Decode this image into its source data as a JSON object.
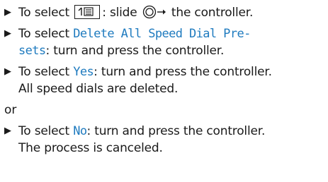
{
  "steps": [
    {
      "pre": "To select ",
      "post": ": slide ",
      "tail": " the controller."
    },
    {
      "pre": "To select ",
      "highlight": "Delete All Speed Dial Pre-",
      "highlight2": "sets",
      "post": ": turn and press the controller."
    },
    {
      "pre": "To select ",
      "highlight": "Yes",
      "post": ": turn and press the controller.",
      "line2": "All speed dials are deleted."
    },
    {
      "pre": "To select ",
      "highlight": "No",
      "post": ": turn and press the controller.",
      "line2": "The process is canceled."
    }
  ],
  "or_text": "or",
  "icons": {
    "bullet": "triangle-right",
    "menu_key": "menu-key-icon",
    "controller": "controller-slide-right-icon"
  },
  "colors": {
    "highlight": "#1f7bbf",
    "text": "#1a1a1a"
  }
}
